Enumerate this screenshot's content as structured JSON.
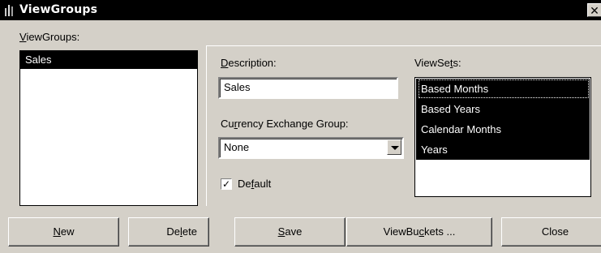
{
  "window": {
    "title": "ViewGroups",
    "close_glyph": "✕"
  },
  "viewgroups": {
    "label": "ViewGroups:",
    "items": [
      {
        "label": "Sales",
        "selected": true
      }
    ]
  },
  "description": {
    "label": "Description:",
    "value": "Sales"
  },
  "currency": {
    "label": "Currency Exchange Group:",
    "value": "None"
  },
  "default": {
    "label": "Default",
    "checked": true,
    "check_glyph": "✓"
  },
  "viewsets": {
    "label": "ViewSets:",
    "items": [
      {
        "label": "Based Months",
        "selected": true
      },
      {
        "label": "Based Years",
        "selected": true
      },
      {
        "label": "Calendar Months",
        "selected": true
      },
      {
        "label": "Years",
        "selected": true
      }
    ]
  },
  "buttons": {
    "new": "New",
    "delete": "Delete",
    "save": "Save",
    "viewbuckets": "ViewBuckets ...",
    "close": "Close"
  },
  "colors": {
    "selection": "#000000",
    "face": "#d4d0c8"
  },
  "icons": {
    "app": "app-icon",
    "dropdown": "chevron-down-icon",
    "close": "close-icon"
  }
}
